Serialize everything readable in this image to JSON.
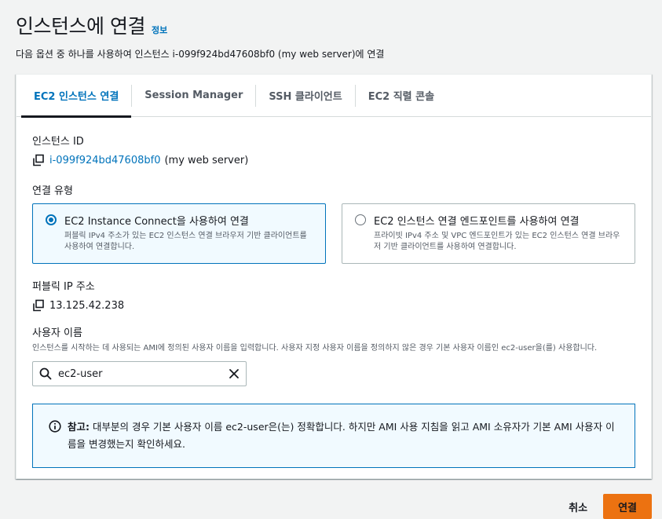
{
  "header": {
    "title": "인스턴스에 연결",
    "info_link": "정보",
    "description": "다음 옵션 중 하나를 사용하여 인스턴스 i-099f924bd47608bf0 (my web server)에 연결"
  },
  "tabs": [
    {
      "label": "EC2 인스턴스 연결",
      "active": true
    },
    {
      "label": "Session Manager",
      "active": false
    },
    {
      "label": "SSH 클라이언트",
      "active": false
    },
    {
      "label": "EC2 직렬 콘솔",
      "active": false
    }
  ],
  "instance": {
    "label": "인스턴스 ID",
    "id": "i-099f924bd47608bf0",
    "name_suffix": "(my web server)"
  },
  "connection_type": {
    "label": "연결 유형",
    "options": [
      {
        "title": "EC2 Instance Connect을 사용하여 연결",
        "description": "퍼블릭 IPv4 주소가 있는 EC2 인스턴스 연결 브라우저 기반 클라이언트를 사용하여 연결합니다.",
        "selected": true
      },
      {
        "title": "EC2 인스턴스 연결 엔드포인트를 사용하여 연결",
        "description": "프라이빗 IPv4 주소 및 VPC 엔드포인트가 있는 EC2 인스턴스 연결 브라우저 기반 클라이언트를 사용하여 연결합니다.",
        "selected": false
      }
    ]
  },
  "public_ip": {
    "label": "퍼블릭 IP 주소",
    "value": "13.125.42.238"
  },
  "username": {
    "label": "사용자 이름",
    "description": "인스턴스를 시작하는 데 사용되는 AMI에 정의된 사용자 이름을 입력합니다. 사용자 지정 사용자 이름을 정의하지 않은 경우 기본 사용자 이름인 ec2-user을(를) 사용합니다.",
    "value": "ec2-user"
  },
  "alert": {
    "prefix": "참고:",
    "text": "대부분의 경우 기본 사용자 이름 ec2-user은(는) 정확합니다. 하지만 AMI 사용 지침을 읽고 AMI 소유자가 기본 AMI 사용자 이름을 변경했는지 확인하세요."
  },
  "footer": {
    "cancel_label": "취소",
    "connect_label": "연결"
  },
  "colors": {
    "accent": "#0073bb",
    "primary_button": "#ec7211",
    "background": "#f2f3f3"
  },
  "icons": {
    "copy": "copy-icon",
    "search": "search-icon",
    "clear": "close-icon",
    "info": "info-icon"
  }
}
